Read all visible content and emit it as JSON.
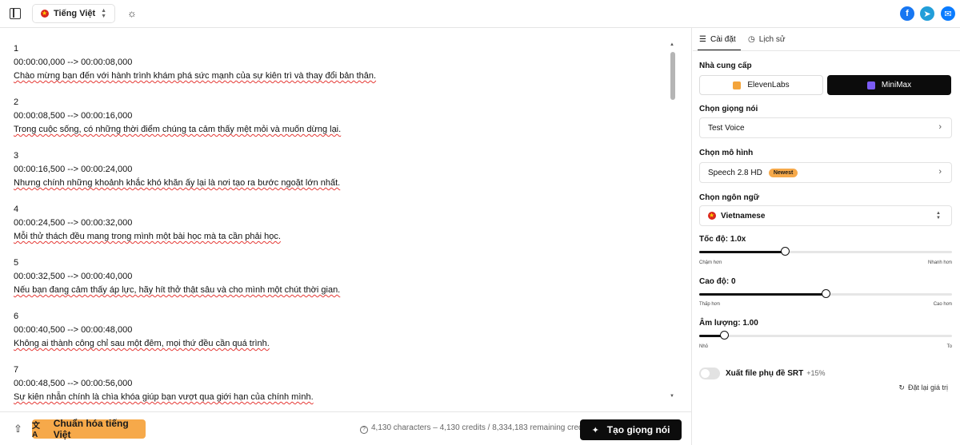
{
  "header": {
    "language": "Tiếng Việt",
    "social": [
      {
        "name": "facebook",
        "glyph": "f"
      },
      {
        "name": "telegram",
        "glyph": "➤"
      },
      {
        "name": "messenger",
        "glyph": "✉"
      }
    ]
  },
  "editor": {
    "blocks": [
      {
        "index": "1",
        "time": "00:00:00,000 --> 00:00:08,000",
        "text": "Chào mừng bạn đến với hành trình khám phá sức mạnh của sự kiên trì và thay đổi bản thân."
      },
      {
        "index": "2",
        "time": "00:00:08,500 --> 00:00:16,000",
        "text": "Trong cuộc sống, có những thời điểm chúng ta cảm thấy mệt mỏi và muốn dừng lại."
      },
      {
        "index": "3",
        "time": "00:00:16,500 --> 00:00:24,000",
        "text": "Nhưng chính những khoảnh khắc khó khăn ấy lại là nơi tạo ra bước ngoặt lớn nhất."
      },
      {
        "index": "4",
        "time": "00:00:24,500 --> 00:00:32,000",
        "text": "Mỗi thử thách đều mang trong mình một bài học mà ta cần phải học."
      },
      {
        "index": "5",
        "time": "00:00:32,500 --> 00:00:40,000",
        "text": "Nếu bạn đang cảm thấy áp lực, hãy hít thở thật sâu và cho mình một chút thời gian."
      },
      {
        "index": "6",
        "time": "00:00:40,500 --> 00:00:48,000",
        "text": "Không ai thành công chỉ sau một đêm, mọi thứ đều cần quá trình."
      },
      {
        "index": "7",
        "time": "00:00:48,500 --> 00:00:56,000",
        "text": "Sự kiên nhẫn chính là chìa khóa giúp bạn vượt qua giới hạn của chính mình."
      }
    ]
  },
  "footer": {
    "normalize_label": "Chuẩn hóa tiếng Việt",
    "credits": "4,130 characters – 4,130 credits / 8,334,183 remaining credits",
    "generate_label": "Tạo giọng nói"
  },
  "panel": {
    "tabs": {
      "settings": "Cài đặt",
      "history": "Lịch sử"
    },
    "provider_label": "Nhà cung cấp",
    "providers": [
      "ElevenLabs",
      "MiniMax"
    ],
    "selected_provider": "MiniMax",
    "voice_label": "Chọn giọng nói",
    "voice_value": "Test Voice",
    "model_label": "Chọn mô hình",
    "model_value": "Speech 2.8 HD",
    "model_badge": "Newest",
    "language_label": "Chọn ngôn ngữ",
    "language_value": "Vietnamese",
    "speed": {
      "label": "Tốc độ: 1.0x",
      "fraction": 0.34,
      "min_label": "Chậm hơn",
      "max_label": "Nhanh hơn"
    },
    "pitch": {
      "label": "Cao độ: 0",
      "fraction": 0.5,
      "min_label": "Thấp hơn",
      "max_label": "Cao hơn"
    },
    "volume": {
      "label": "Âm lượng: 1.00",
      "fraction": 0.1,
      "min_label": "Nhỏ",
      "max_label": "To"
    },
    "srt_toggle": {
      "label": "Xuất file phụ đề SRT",
      "extra": "+15%",
      "on": false
    },
    "reset_label": "Đặt lại giá trị"
  }
}
